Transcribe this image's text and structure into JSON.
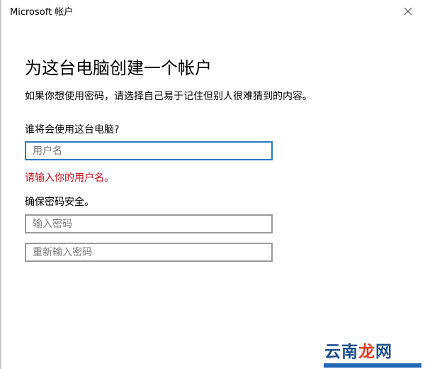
{
  "window": {
    "title": "Microsoft 帐户"
  },
  "heading": "为这台电脑创建一个帐户",
  "description": "如果你想使用密码，请选择自己易于记住但别人很难猜到的内容。",
  "username_section": {
    "question": "谁将会使用这台电脑?",
    "input": {
      "placeholder": "用户名",
      "value": ""
    },
    "error": "请输入你的用户名。"
  },
  "password_section": {
    "label": "确保密码安全。",
    "password": {
      "placeholder": "输入密码",
      "value": ""
    },
    "confirm": {
      "placeholder": "重新输入密码",
      "value": ""
    }
  },
  "watermark": {
    "part1": "云南",
    "part2": "龙",
    "part3": "网"
  },
  "colors": {
    "error": "#c50f1f",
    "focus_border": "#2a7ac8",
    "field_border": "#999999"
  },
  "icons": {
    "close": "close-icon"
  }
}
